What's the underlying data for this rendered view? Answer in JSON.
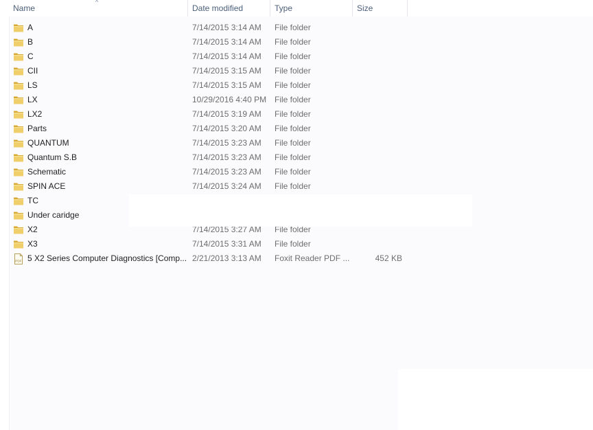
{
  "columns": {
    "name": "Name",
    "date": "Date modified",
    "type": "Type",
    "size": "Size"
  },
  "sort_icon": "chevron-up-icon",
  "files": [
    {
      "name": "A",
      "date": "7/14/2015 3:14 AM",
      "type": "File folder",
      "size": "",
      "icon": "folder-icon"
    },
    {
      "name": "B",
      "date": "7/14/2015 3:14 AM",
      "type": "File folder",
      "size": "",
      "icon": "folder-icon"
    },
    {
      "name": "C",
      "date": "7/14/2015 3:14 AM",
      "type": "File folder",
      "size": "",
      "icon": "folder-icon"
    },
    {
      "name": "CII",
      "date": "7/14/2015 3:15 AM",
      "type": "File folder",
      "size": "",
      "icon": "folder-icon"
    },
    {
      "name": "LS",
      "date": "7/14/2015 3:15 AM",
      "type": "File folder",
      "size": "",
      "icon": "folder-icon"
    },
    {
      "name": "LX",
      "date": "10/29/2016 4:40 PM",
      "type": "File folder",
      "size": "",
      "icon": "folder-icon"
    },
    {
      "name": "LX2",
      "date": "7/14/2015 3:19 AM",
      "type": "File folder",
      "size": "",
      "icon": "folder-icon"
    },
    {
      "name": "Parts",
      "date": "7/14/2015 3:20 AM",
      "type": "File folder",
      "size": "",
      "icon": "folder-icon"
    },
    {
      "name": "QUANTUM",
      "date": "7/14/2015 3:23 AM",
      "type": "File folder",
      "size": "",
      "icon": "folder-icon"
    },
    {
      "name": "Quantum S.B",
      "date": "7/14/2015 3:23 AM",
      "type": "File folder",
      "size": "",
      "icon": "folder-icon"
    },
    {
      "name": "Schematic",
      "date": "7/14/2015 3:23 AM",
      "type": "File folder",
      "size": "",
      "icon": "folder-icon"
    },
    {
      "name": "SPIN ACE",
      "date": "7/14/2015 3:24 AM",
      "type": "File folder",
      "size": "",
      "icon": "folder-icon"
    },
    {
      "name": "TC",
      "date": "",
      "type": "",
      "size": "",
      "icon": "folder-icon"
    },
    {
      "name": "Under caridge",
      "date": "",
      "type": "",
      "size": "",
      "icon": "folder-icon"
    },
    {
      "name": "X2",
      "date": "7/14/2015 3:27 AM",
      "type": "File folder",
      "size": "",
      "icon": "folder-icon"
    },
    {
      "name": "X3",
      "date": "7/14/2015 3:31 AM",
      "type": "File folder",
      "size": "",
      "icon": "folder-icon"
    },
    {
      "name": "5 X2 Series Computer Diagnostics [Comp...",
      "date": "2/21/2013 3:13 AM",
      "type": "Foxit Reader PDF ...",
      "size": "452 KB",
      "icon": "pdf-file-icon",
      "icon_label": "PDF"
    }
  ],
  "colors": {
    "header_text": "#4c607a",
    "name_text": "#1e1e1e",
    "detail_text": "#6d6d6d",
    "folder": "#e9c45c"
  }
}
